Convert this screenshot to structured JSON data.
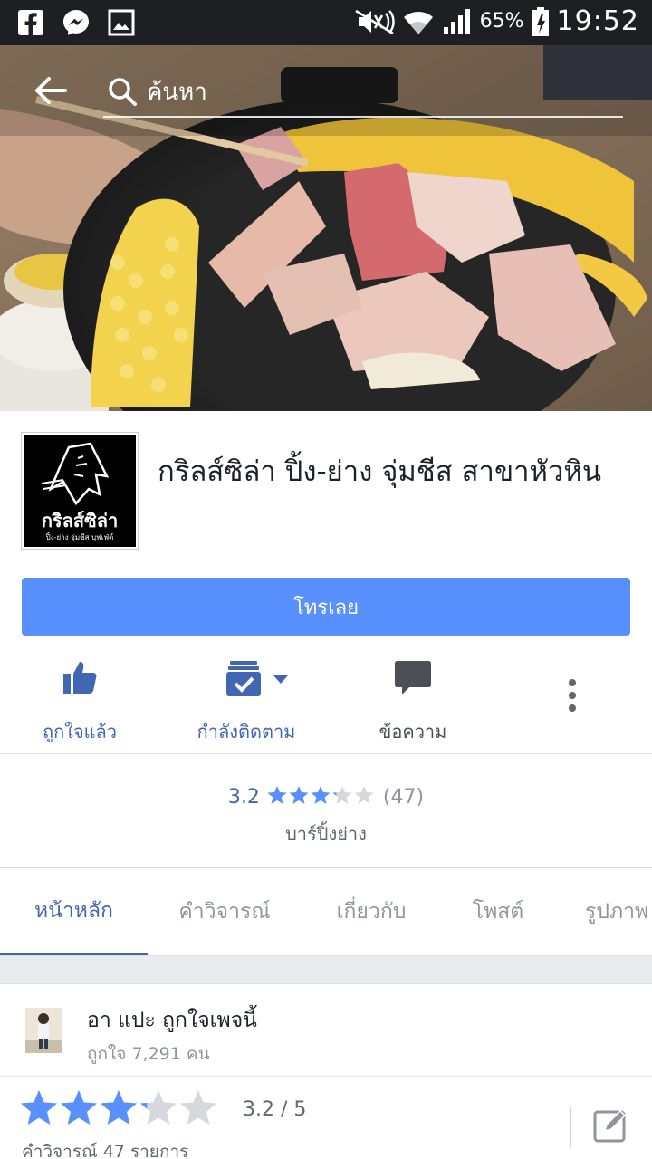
{
  "status_bar": {
    "battery": "65%",
    "time": "19:52",
    "icons": [
      "facebook-icon",
      "messenger-icon",
      "gallery-icon",
      "mute-icon",
      "wifi-icon",
      "signal-icon",
      "battery-icon"
    ]
  },
  "header": {
    "search_placeholder": "ค้นหา"
  },
  "page": {
    "name": "กริลส์ซิล่า ปิ้ง-ย่าง จุ่มชีส สาขาหัวหิน",
    "call_button": "โทรเลย",
    "actions": {
      "like": "ถูกใจแล้ว",
      "follow": "กำลังติดตาม",
      "message": "ข้อความ"
    },
    "rating": {
      "score": "3.2",
      "stars": 3.2,
      "count": "(47)",
      "category": "บาร์ปิ้งย่าง"
    }
  },
  "tabs": [
    {
      "label": "หน้าหลัก",
      "active": true
    },
    {
      "label": "คำวิจารณ์",
      "active": false
    },
    {
      "label": "เกี่ยวกับ",
      "active": false
    },
    {
      "label": "โพสต์",
      "active": false
    },
    {
      "label": "รูปภาพ",
      "active": false
    }
  ],
  "feed": {
    "friend_like": "อา แปะ ถูกใจเพจนี้",
    "likes": "ถูกใจ 7,291 คน",
    "review_score": "3.2 / 5",
    "review_count": "คำวิจารณ์ 47 รายการ"
  },
  "colors": {
    "accent": "#4267b2",
    "button": "#5890ff",
    "star_on": "#5890ff",
    "star_off": "#d5d8dd"
  }
}
